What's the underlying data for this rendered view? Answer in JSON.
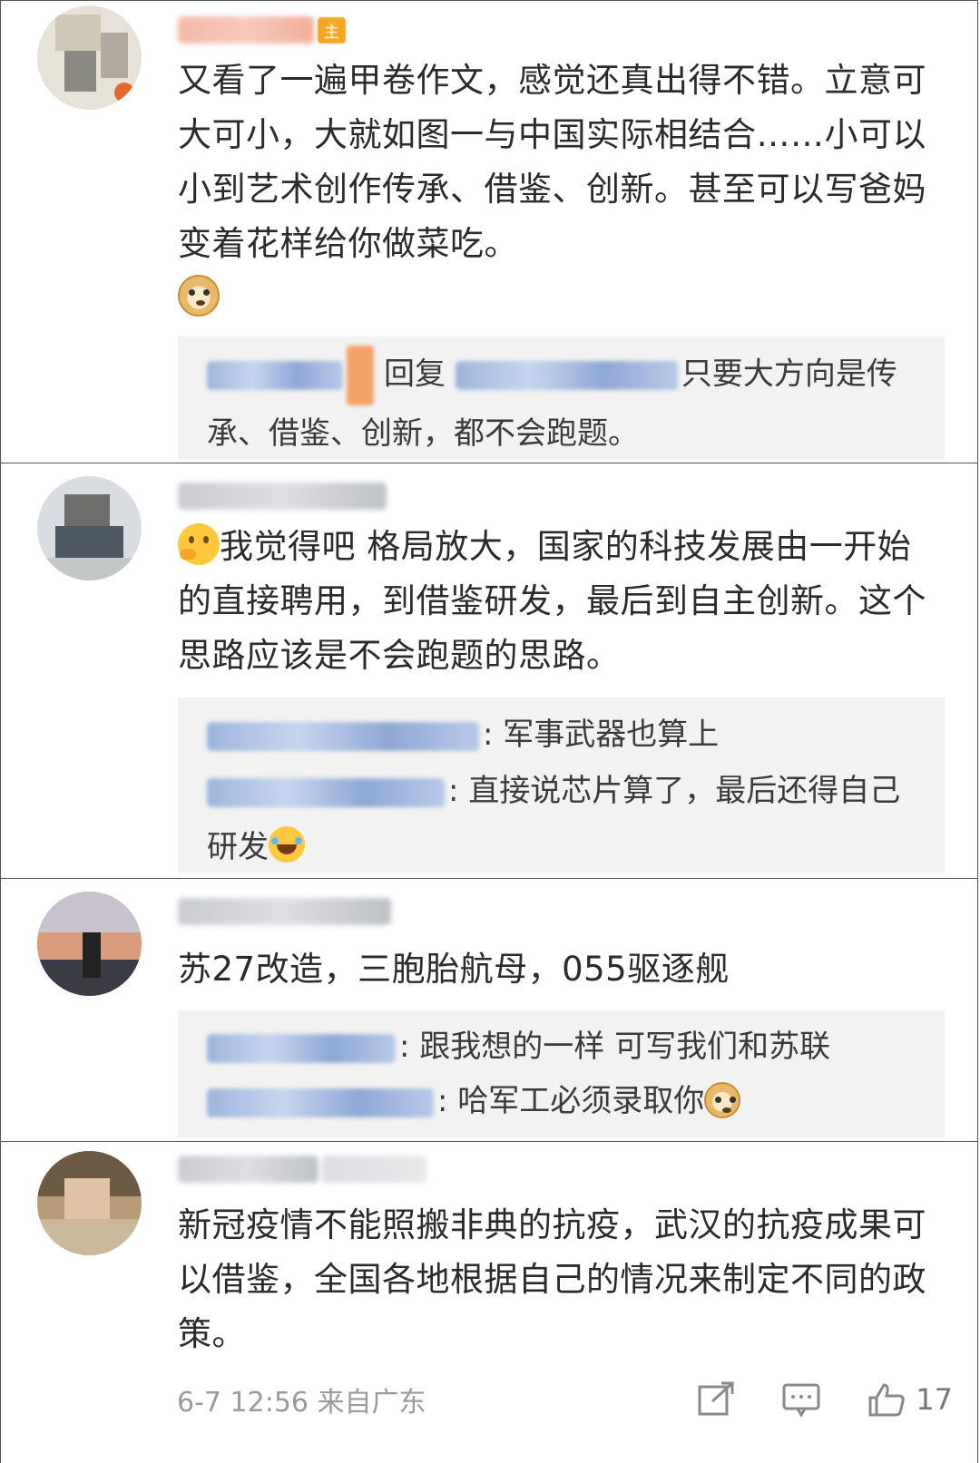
{
  "comments": [
    {
      "author": "无为李铭",
      "badge": "主",
      "text": "又看了一遍甲卷作文，感觉还真出得不错。立意可大可小，大就如图一与中国实际相结合……小可以小到艺术创作传承、借鉴、创新。甚至可以写爸妈变着花样给你做菜吃。",
      "emoji": "doge-emoji",
      "replies": [
        {
          "author": "无为李铭",
          "verb": "回复",
          "target": "@GRACEYOU",
          "text": "只要大方向是传承、借鉴、创新，都不会跑题。"
        }
      ]
    },
    {
      "author": "王景佳的翻板",
      "emoji": "thinking-emoji",
      "text": "我觉得吧 格局放大，国家的科技发展由一开始的直接聘用，到借鉴研发，最后到自主创新。这个思路应该是不会跑题的思路。",
      "replies": [
        {
          "author": "某色彩层层播种队长",
          "text": ": 军事武器也算上"
        },
        {
          "author": "金工程看看新闻",
          "text": ": 直接说芯片算了，最后还得自己研发"
        }
      ]
    },
    {
      "author": "晴朗晴天星河",
      "text": "苏27改造，三胞胎航母，055驱逐舰",
      "replies": [
        {
          "author": "luoheshangri",
          "text": ": 跟我想的一样 可写我们和苏联"
        },
        {
          "author": "军用物资是谁",
          "text": ": 哈军工必须录取你"
        }
      ]
    },
    {
      "author": "陈陈陈陈",
      "author_suffix": "zrrrrrrr",
      "text": "新冠疫情不能照搬非典的抗疫，武汉的抗疫成果可以借鉴，全国各地根据自己的情况来制定不同的政策。",
      "footer": {
        "date": "6-7 12:56",
        "source": "来自广东",
        "likes": "17"
      }
    }
  ],
  "colors": {
    "reply_bg": "#f2f2f2",
    "text": "#2b2b2b",
    "muted": "#9a9a9a",
    "blurred_name": "#9db5dc",
    "badge": "#f5a623"
  }
}
